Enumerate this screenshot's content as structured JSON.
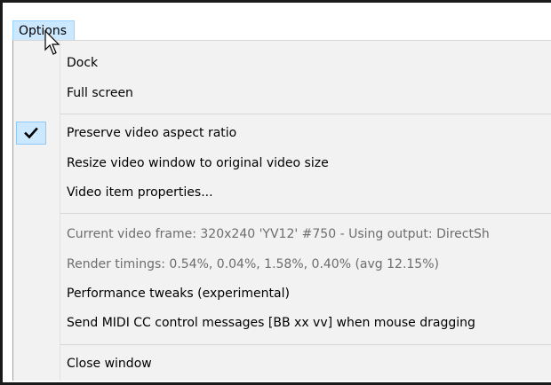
{
  "menubar": {
    "options_label": "Options"
  },
  "menu": {
    "items": [
      {
        "label": "Dock",
        "checked": false,
        "disabled": false
      },
      {
        "label": "Full screen",
        "checked": false,
        "disabled": false
      },
      {
        "label": "Preserve video aspect ratio",
        "checked": true,
        "disabled": false
      },
      {
        "label": "Resize video window to original video size",
        "checked": false,
        "disabled": false
      },
      {
        "label": "Video item properties...",
        "checked": false,
        "disabled": false
      },
      {
        "label": "Current video frame: 320x240 'YV12' #750 - Using output: DirectSh",
        "checked": false,
        "disabled": true
      },
      {
        "label": "Render timings: 0.54%, 0.04%, 1.58%, 0.40% (avg 12.15%)",
        "checked": false,
        "disabled": true
      },
      {
        "label": "Performance tweaks (experimental)",
        "checked": false,
        "disabled": false
      },
      {
        "label": "Send MIDI CC control messages [BB xx vv] when mouse dragging",
        "checked": false,
        "disabled": false
      },
      {
        "label": "Close window",
        "checked": false,
        "disabled": false
      }
    ]
  },
  "colors": {
    "menu_background": "#f2f2f2",
    "highlight": "#cce8ff",
    "highlight_border": "#99d1ff",
    "disabled_text": "#6d6d6d"
  },
  "icons": {
    "check": "checkmark-icon",
    "pointer": "mouse-pointer-icon"
  }
}
